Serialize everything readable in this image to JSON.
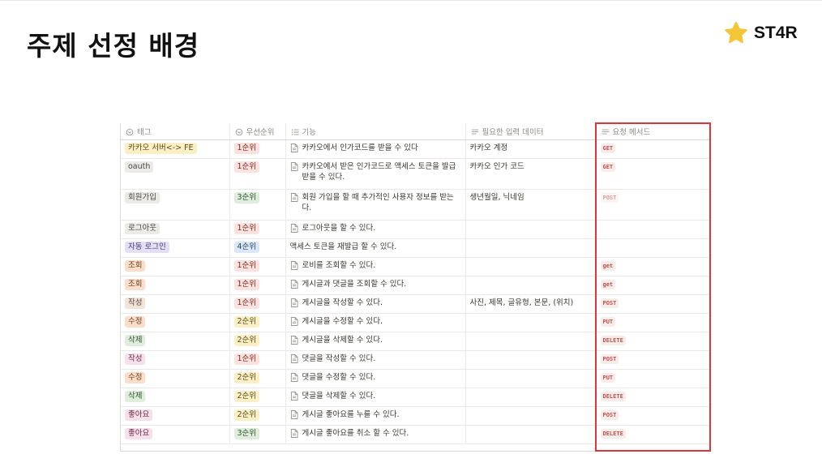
{
  "title": "주제 선정 배경",
  "logo": {
    "text": "ST4R",
    "icon": "star-icon",
    "star_color": "#f4c534"
  },
  "highlight_color": "#d9363e",
  "headers": {
    "tag": "태그",
    "priority": "우선순위",
    "function": "기능",
    "input": "필요한 입력 데이터",
    "method": "요청 메서드"
  },
  "tag_colors": {
    "yellow": {
      "bg": "#fbf0c5",
      "fg": "#5b4a1a"
    },
    "gray": {
      "bg": "#ebeae7",
      "fg": "#4a4843"
    },
    "brown": {
      "bg": "#f1e4d8",
      "fg": "#5a4433"
    },
    "orange": {
      "bg": "#fbdec9",
      "fg": "#6b3f1d"
    },
    "blue": {
      "bg": "#dbe7f4",
      "fg": "#2a4a6b"
    },
    "purple": {
      "bg": "#e5dff4",
      "fg": "#4a3a74"
    },
    "green": {
      "bg": "#dfeddc",
      "fg": "#2f5430"
    },
    "pink": {
      "bg": "#f6e0ea",
      "fg": "#6b2c4a"
    },
    "red": {
      "bg": "#fbe2df",
      "fg": "#7a2b22"
    }
  },
  "method_style": {
    "bg": "#f7ecea",
    "fg": "#c0504d"
  },
  "rows": [
    {
      "tag": "카카오 서버<-> FE",
      "tag_color": "yellow",
      "priority": "1순위",
      "pri_color": "red",
      "function": "카카오에서 인가코드를 받을 수 있다",
      "has_doc": true,
      "input": "카카오 계정",
      "method": "GET",
      "h": 1
    },
    {
      "tag": "oauth",
      "tag_color": "gray",
      "priority": "1순위",
      "pri_color": "red",
      "function": "카카오에서 받은 인가코드로 액세스 토큰을 발급 받을 수 있다.",
      "has_doc": true,
      "input": "카카오 인가 코드",
      "method": "GET",
      "h": 2
    },
    {
      "tag": "회원가입",
      "tag_color": "gray",
      "priority": "3순위",
      "pri_color": "green",
      "function": "회원 가입을 할 때 추가적인 사용자 정보를 받는다.",
      "has_doc": true,
      "input": "생년월일, 닉네임",
      "method": "POST",
      "h": 2,
      "faint": true
    },
    {
      "tag": "로그아웃",
      "tag_color": "gray",
      "priority": "1순위",
      "pri_color": "red",
      "function": "로그아웃을 할 수 있다.",
      "has_doc": true,
      "input": "",
      "method": "",
      "h": 1
    },
    {
      "tag": "자동 로그인",
      "tag_color": "purple",
      "priority": "4순위",
      "pri_color": "blue",
      "function": "액세스 토큰을 재발급 할 수 있다.",
      "has_doc": false,
      "input": "",
      "method": "",
      "h": 1
    },
    {
      "tag": "조회",
      "tag_color": "orange",
      "priority": "1순위",
      "pri_color": "red",
      "function": "로비를 조회할 수 있다.",
      "has_doc": true,
      "input": "",
      "method": "get",
      "h": 1
    },
    {
      "tag": "조회",
      "tag_color": "orange",
      "priority": "1순위",
      "pri_color": "red",
      "function": "게시글과 댓글을 조회할 수 있다.",
      "has_doc": true,
      "input": "",
      "method": "get",
      "h": 1
    },
    {
      "tag": "작성",
      "tag_color": "brown",
      "priority": "1순위",
      "pri_color": "red",
      "function": "게시글을 작성할 수 있다.",
      "has_doc": true,
      "input": "사진, 제목, 글유형, 본문, (위치)",
      "method": "POST",
      "h": 1
    },
    {
      "tag": "수정",
      "tag_color": "orange",
      "priority": "2순위",
      "pri_color": "yellow",
      "function": "게시글을 수정할 수 있다.",
      "has_doc": true,
      "input": "",
      "method": "PUT",
      "h": 1
    },
    {
      "tag": "삭제",
      "tag_color": "green",
      "priority": "2순위",
      "pri_color": "yellow",
      "function": "게시글을 삭제할 수 있다.",
      "has_doc": true,
      "input": "",
      "method": "DELETE",
      "h": 1
    },
    {
      "tag": "작성",
      "tag_color": "pink",
      "priority": "1순위",
      "pri_color": "red",
      "function": "댓글을 작성할 수 있다.",
      "has_doc": true,
      "input": "",
      "method": "POST",
      "h": 1
    },
    {
      "tag": "수정",
      "tag_color": "orange",
      "priority": "2순위",
      "pri_color": "yellow",
      "function": "댓글을 수정할 수 있다.",
      "has_doc": true,
      "input": "",
      "method": "PUT",
      "h": 1
    },
    {
      "tag": "삭제",
      "tag_color": "green",
      "priority": "2순위",
      "pri_color": "yellow",
      "function": "댓글을 삭제할 수 있다.",
      "has_doc": true,
      "input": "",
      "method": "DELETE",
      "h": 1
    },
    {
      "tag": "좋아요",
      "tag_color": "pink",
      "priority": "2순위",
      "pri_color": "yellow",
      "function": "게시글 좋아요를 누를 수 있다.",
      "has_doc": true,
      "input": "",
      "method": "POST",
      "h": 1
    },
    {
      "tag": "좋아요",
      "tag_color": "pink",
      "priority": "3순위",
      "pri_color": "green",
      "function": "게시글 좋아요를 취소 할 수 있다.",
      "has_doc": true,
      "input": "",
      "method": "DELETE",
      "h": 1
    }
  ]
}
